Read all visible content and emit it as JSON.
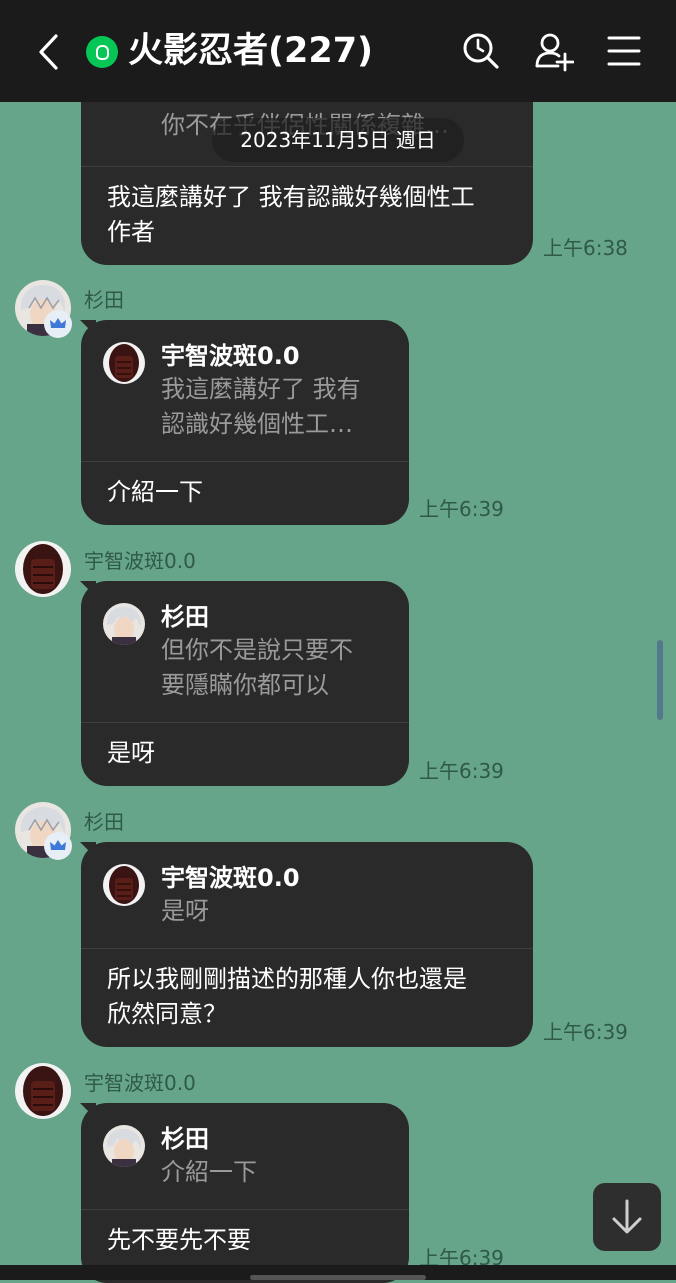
{
  "header": {
    "title": "火影忍者(227)",
    "colors": {
      "bar": "#1b1b1b",
      "badge": "#06c755"
    }
  },
  "date_separator": "2023年11月5日 週日",
  "top_bubble": {
    "quote_text": "你不在乎伴侶性關係複雜…",
    "text": "我這麼講好了 我有認識好幾個性工\n作者",
    "time": "上午6:38"
  },
  "messages": [
    {
      "sender": "杉田",
      "quote_name": "宇智波斑0.0",
      "quote_text": "我這麼講好了 我有\n認識好幾個性工…",
      "text": "介紹一下",
      "time": "上午6:39"
    },
    {
      "sender": "宇智波斑0.0",
      "quote_name": "杉田",
      "quote_text": "但你不是說只要不\n要隱瞞你都可以",
      "text": "是呀",
      "time": "上午6:39"
    },
    {
      "sender": "杉田",
      "quote_name": "宇智波斑0.0",
      "quote_text": "是呀",
      "text": "所以我剛剛描述的那種人你也還是\n欣然同意？",
      "time": "上午6:39"
    },
    {
      "sender": "宇智波斑0.0",
      "quote_name": "杉田",
      "quote_text": "介紹一下",
      "text": "先不要先不要",
      "time": "上午6:39"
    }
  ],
  "icons": [
    "back-icon",
    "group-badge-icon",
    "search-icon",
    "add-friend-icon",
    "menu-icon",
    "scroll-down-icon",
    "crown-icon"
  ],
  "colors": {
    "background": "#66a58a",
    "bubble": "#2a2a2a",
    "time": "#2f5a47"
  }
}
